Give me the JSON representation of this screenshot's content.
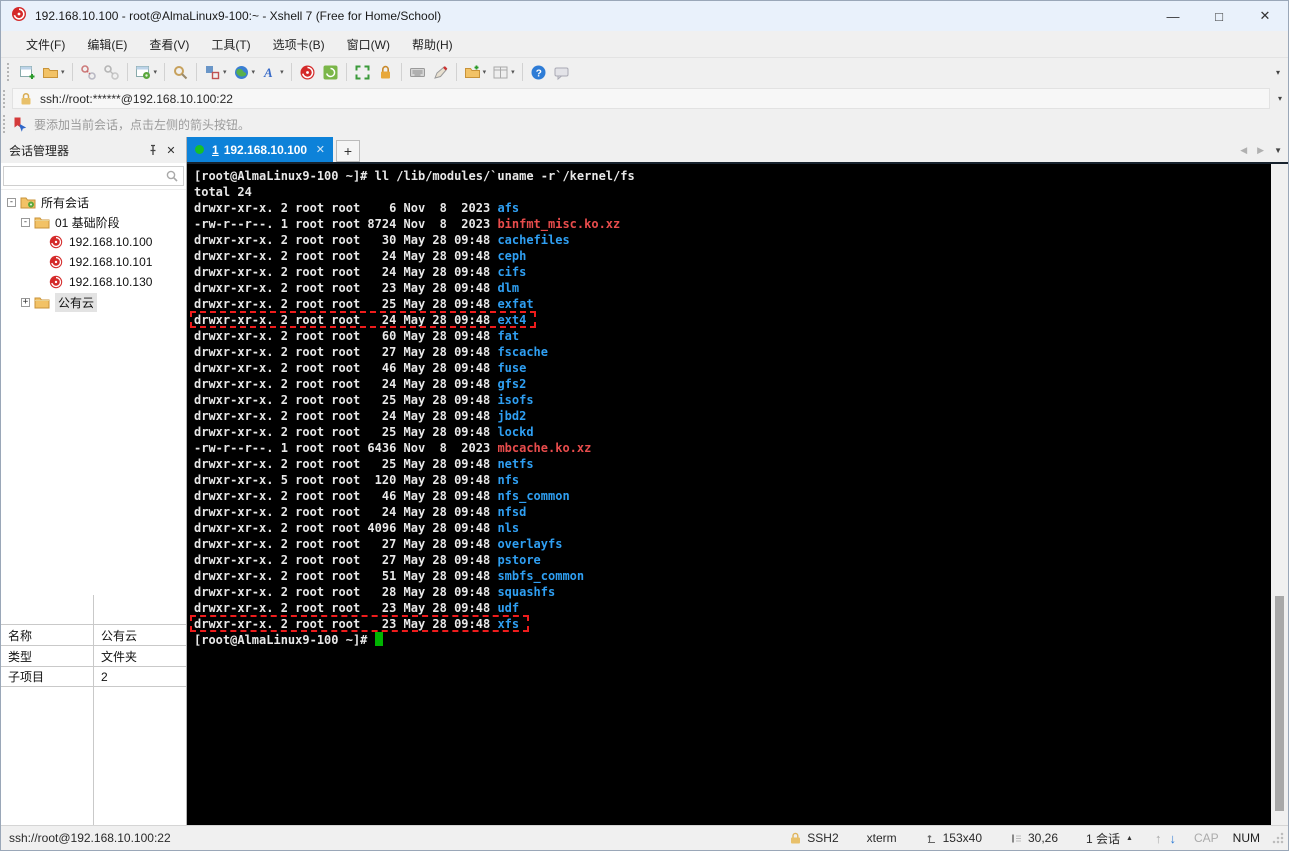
{
  "window": {
    "title": "192.168.10.100 - root@AlmaLinux9-100:~ - Xshell 7 (Free for Home/School)",
    "controls": {
      "minimize": "—",
      "maximize": "□",
      "close": "✕"
    }
  },
  "menu": {
    "items": [
      "文件(F)",
      "编辑(E)",
      "查看(V)",
      "工具(T)",
      "选项卡(B)",
      "窗口(W)",
      "帮助(H)"
    ]
  },
  "toolbar": {
    "buttons": [
      {
        "name": "new-session",
        "dropdown": false
      },
      {
        "name": "open-sessions",
        "dropdown": true
      },
      {
        "sep": true
      },
      {
        "name": "disconnect",
        "dropdown": false
      },
      {
        "name": "reconnect",
        "dropdown": false
      },
      {
        "sep": true
      },
      {
        "name": "session-properties",
        "dropdown": true
      },
      {
        "sep": true
      },
      {
        "name": "find",
        "dropdown": false
      },
      {
        "sep": true
      },
      {
        "name": "layout",
        "dropdown": true
      },
      {
        "name": "web",
        "dropdown": true
      },
      {
        "name": "font",
        "dropdown": true
      },
      {
        "sep": true
      },
      {
        "name": "xshell",
        "dropdown": false
      },
      {
        "name": "xftp",
        "dropdown": false
      },
      {
        "sep": true
      },
      {
        "name": "fullscreen",
        "dropdown": false
      },
      {
        "name": "lock-screen",
        "dropdown": false
      },
      {
        "sep": true
      },
      {
        "name": "virtual-keyboard",
        "dropdown": false
      },
      {
        "name": "compose",
        "dropdown": false
      },
      {
        "sep": true
      },
      {
        "name": "new-file",
        "dropdown": true
      },
      {
        "name": "tile-windows",
        "dropdown": true
      },
      {
        "sep": true
      },
      {
        "name": "help",
        "dropdown": false
      },
      {
        "name": "feedback",
        "dropdown": false
      }
    ],
    "overflow_arrow": "▾"
  },
  "address_bar": {
    "value": "ssh://root:******@192.168.10.100:22",
    "dropdown_arrow": "▾"
  },
  "info_bar": {
    "text": "要添加当前会话，点击左侧的箭头按钮。"
  },
  "sidebar": {
    "title": "会话管理器",
    "search": {
      "placeholder": ""
    },
    "tree": [
      {
        "label": "所有会话",
        "depth": 0,
        "icon": "folder-gear",
        "expander": "-"
      },
      {
        "label": "01 基础阶段",
        "depth": 1,
        "icon": "folder",
        "expander": "-"
      },
      {
        "label": "192.168.10.100",
        "depth": 2,
        "icon": "xshell-session",
        "expander": ""
      },
      {
        "label": "192.168.10.101",
        "depth": 2,
        "icon": "xshell-session",
        "expander": ""
      },
      {
        "label": "192.168.10.130",
        "depth": 2,
        "icon": "xshell-session",
        "expander": ""
      },
      {
        "label": "公有云",
        "depth": 1,
        "icon": "folder",
        "expander": "+",
        "selected": true
      }
    ],
    "properties": [
      {
        "key": "名称",
        "value": "公有云"
      },
      {
        "key": "类型",
        "value": "文件夹"
      },
      {
        "key": "子项目",
        "value": "2"
      }
    ]
  },
  "tabs": {
    "active": {
      "number": "1",
      "label": "192.168.10.100",
      "close": "✕"
    },
    "new_tab_label": "+",
    "nav_prev": "◀",
    "nav_next": "▶",
    "nav_dropdown": "▼"
  },
  "terminal": {
    "colors": {
      "background": "#000000",
      "foreground": "#e8e8e8",
      "directory": "#2f9ff2",
      "archive": "#e84c4c",
      "cursor": "#00b400",
      "highlight_box": "#ee1c1c"
    },
    "lines": [
      {
        "type": "plain",
        "text": "[root@AlmaLinux9-100 ~]# ll /lib/modules/`uname -r`/kernel/fs"
      },
      {
        "type": "plain",
        "text": "total 24"
      },
      {
        "type": "dir",
        "pre": "drwxr-xr-x. 2 root root    6 Nov  8  2023 ",
        "name": "afs"
      },
      {
        "type": "file",
        "pre": "-rw-r--r--. 1 root root 8724 Nov  8  2023 ",
        "name": "binfmt_misc.ko.xz"
      },
      {
        "type": "dir",
        "pre": "drwxr-xr-x. 2 root root   30 May 28 09:48 ",
        "name": "cachefiles"
      },
      {
        "type": "dir",
        "pre": "drwxr-xr-x. 2 root root   24 May 28 09:48 ",
        "name": "ceph"
      },
      {
        "type": "dir",
        "pre": "drwxr-xr-x. 2 root root   24 May 28 09:48 ",
        "name": "cifs"
      },
      {
        "type": "dir",
        "pre": "drwxr-xr-x. 2 root root   23 May 28 09:48 ",
        "name": "dlm"
      },
      {
        "type": "dir",
        "pre": "drwxr-xr-x. 2 root root   25 May 28 09:48 ",
        "name": "exfat"
      },
      {
        "type": "dir",
        "pre": "drwxr-xr-x. 2 root root   24 May 28 09:48 ",
        "name": "ext4",
        "highlight": true
      },
      {
        "type": "dir",
        "pre": "drwxr-xr-x. 2 root root   60 May 28 09:48 ",
        "name": "fat"
      },
      {
        "type": "dir",
        "pre": "drwxr-xr-x. 2 root root   27 May 28 09:48 ",
        "name": "fscache"
      },
      {
        "type": "dir",
        "pre": "drwxr-xr-x. 2 root root   46 May 28 09:48 ",
        "name": "fuse"
      },
      {
        "type": "dir",
        "pre": "drwxr-xr-x. 2 root root   24 May 28 09:48 ",
        "name": "gfs2"
      },
      {
        "type": "dir",
        "pre": "drwxr-xr-x. 2 root root   25 May 28 09:48 ",
        "name": "isofs"
      },
      {
        "type": "dir",
        "pre": "drwxr-xr-x. 2 root root   24 May 28 09:48 ",
        "name": "jbd2"
      },
      {
        "type": "dir",
        "pre": "drwxr-xr-x. 2 root root   25 May 28 09:48 ",
        "name": "lockd"
      },
      {
        "type": "file",
        "pre": "-rw-r--r--. 1 root root 6436 Nov  8  2023 ",
        "name": "mbcache.ko.xz"
      },
      {
        "type": "dir",
        "pre": "drwxr-xr-x. 2 root root   25 May 28 09:48 ",
        "name": "netfs"
      },
      {
        "type": "dir",
        "pre": "drwxr-xr-x. 5 root root  120 May 28 09:48 ",
        "name": "nfs"
      },
      {
        "type": "dir",
        "pre": "drwxr-xr-x. 2 root root   46 May 28 09:48 ",
        "name": "nfs_common"
      },
      {
        "type": "dir",
        "pre": "drwxr-xr-x. 2 root root   24 May 28 09:48 ",
        "name": "nfsd"
      },
      {
        "type": "dir",
        "pre": "drwxr-xr-x. 2 root root 4096 May 28 09:48 ",
        "name": "nls"
      },
      {
        "type": "dir",
        "pre": "drwxr-xr-x. 2 root root   27 May 28 09:48 ",
        "name": "overlayfs"
      },
      {
        "type": "dir",
        "pre": "drwxr-xr-x. 2 root root   27 May 28 09:48 ",
        "name": "pstore"
      },
      {
        "type": "dir",
        "pre": "drwxr-xr-x. 2 root root   51 May 28 09:48 ",
        "name": "smbfs_common"
      },
      {
        "type": "dir",
        "pre": "drwxr-xr-x. 2 root root   28 May 28 09:48 ",
        "name": "squashfs"
      },
      {
        "type": "dir",
        "pre": "drwxr-xr-x. 2 root root   23 May 28 09:48 ",
        "name": "udf"
      },
      {
        "type": "dir",
        "pre": "drwxr-xr-x. 2 root root   23 May 28 09:48 ",
        "name": "xfs",
        "highlight": true
      },
      {
        "type": "prompt",
        "text": "[root@AlmaLinux9-100 ~]# ",
        "cursor": true
      }
    ]
  },
  "status_bar": {
    "left": "ssh://root@192.168.10.100:22",
    "protocol": "SSH2",
    "term_type": "xterm",
    "size": "153x40",
    "cursor_pos": "30,26",
    "session_count": "1 会话",
    "session_dd": "▲",
    "arrow_up": "↑",
    "arrow_down": "↓",
    "cap": "CAP",
    "num": "NUM"
  }
}
